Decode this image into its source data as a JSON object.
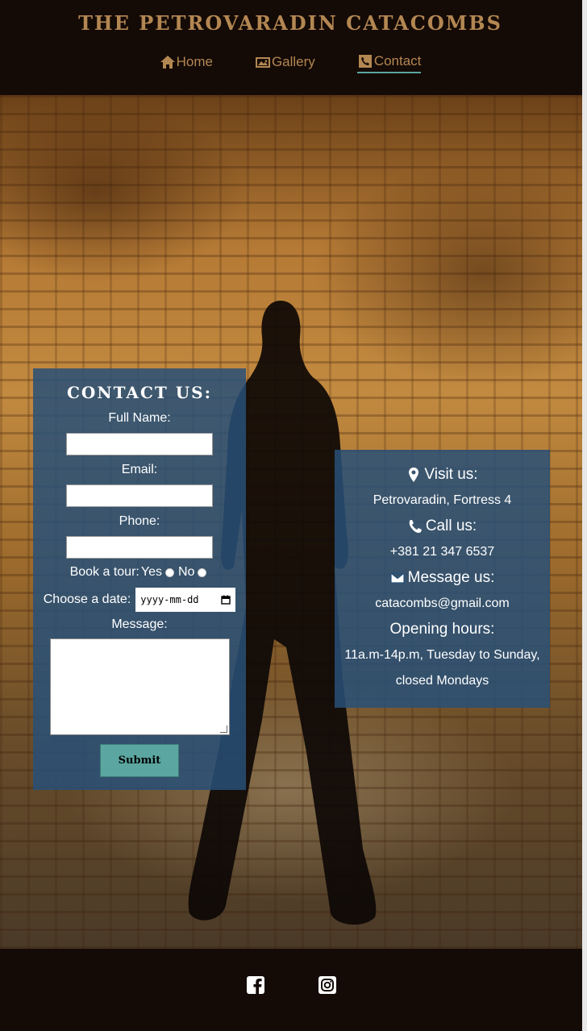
{
  "header": {
    "title": "THE PETROVARADIN CATACOMBS",
    "nav": [
      {
        "label": "Home",
        "icon": "home-icon"
      },
      {
        "label": "Gallery",
        "icon": "image-icon"
      },
      {
        "label": "Contact",
        "icon": "phone-square-icon",
        "active": true
      }
    ]
  },
  "form": {
    "title": "CONTACT US:",
    "full_name_label": "Full Name:",
    "email_label": "Email:",
    "phone_label": "Phone:",
    "book_tour_label": "Book a tour:",
    "yes_label": "Yes",
    "no_label": "No",
    "date_label": "Choose a date:",
    "date_placeholder": "yyyy-mm-dd",
    "message_label": "Message:",
    "submit_label": "Submit"
  },
  "info": {
    "visit_heading": "Visit us:",
    "visit_text": "Petrovaradin, Fortress 4",
    "call_heading": "Call us:",
    "call_text": "+381 21 347 6537",
    "message_heading": "Message us:",
    "message_text": "catacombs@gmail.com",
    "hours_heading": "Opening hours:",
    "hours_line1": "11a.m-14p.m, Tuesday to Sunday,",
    "hours_line2": "closed Mondays"
  },
  "footer": {
    "social": [
      "facebook-icon",
      "instagram-icon"
    ]
  },
  "colors": {
    "accent": "#b38752",
    "dark": "#140a06",
    "panel": "#28507a",
    "button": "#5ba6a0"
  }
}
